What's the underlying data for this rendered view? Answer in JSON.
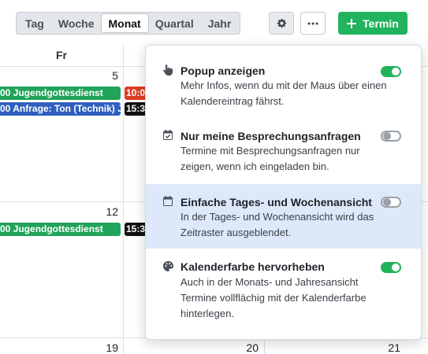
{
  "toolbar": {
    "views": [
      "Tag",
      "Woche",
      "Monat",
      "Quartal",
      "Jahr"
    ],
    "active_view": "Monat",
    "settings_icon": "gear-icon",
    "more_icon": "more-dots-icon",
    "new_button_label": "Termin",
    "new_button_icon": "plus-icon"
  },
  "calendar": {
    "day_header": "Fr",
    "day_numbers": [
      "5",
      "12",
      "19",
      "20",
      "21"
    ],
    "events": {
      "row1_green": "00  Jugendgottesdienst",
      "row1_red": "10:0",
      "row1_blue": "00  Anfrage: Ton (Technik) Jug",
      "row1_black": "15:3",
      "row2_green": "00  Jugendgottesdienst",
      "row2_black": "15:3"
    }
  },
  "popup": {
    "options": [
      {
        "title": "Popup anzeigen",
        "description": "Mehr Infos, wenn du mit der Maus über einen Kalendereintrag fährst.",
        "icon": "pointer-hand-icon",
        "enabled": true
      },
      {
        "title": "Nur meine Besprechungsanfragen",
        "description": "Termine mit Besprechungsanfragen nur zeigen, wenn ich eingeladen bin.",
        "icon": "calendar-check-icon",
        "enabled": false
      },
      {
        "title": "Einfache Tages- und Wochenansicht",
        "description": "In der Tages- und Wochenansicht wird das Zeitraster ausgeblendet.",
        "icon": "calendar-icon",
        "enabled": false
      },
      {
        "title": "Kalenderfarbe hervorheben",
        "description": "Auch in der Monats- und Jahresansicht Termine vollflächig mit der Kalenderfarbe hinterlegen.",
        "icon": "palette-icon",
        "enabled": true
      }
    ]
  },
  "colors": {
    "accent_green": "#22b35e",
    "event_blue": "#2f5fbf",
    "event_red": "#e03b24",
    "highlight_row": "#dde9fb"
  }
}
